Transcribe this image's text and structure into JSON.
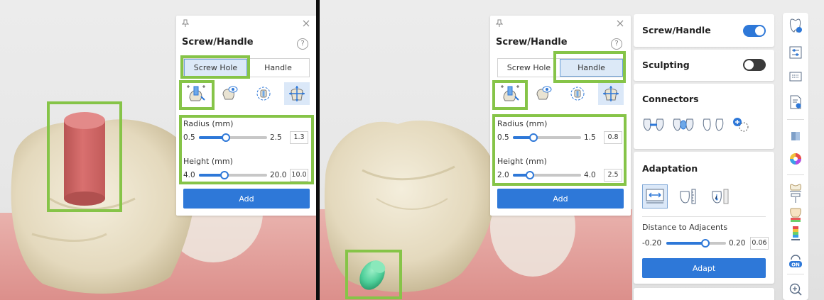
{
  "left_pane": {
    "panel": {
      "title": "Screw/Handle",
      "help": "?",
      "tabs": [
        {
          "label": "Screw Hole",
          "active": true
        },
        {
          "label": "Handle",
          "active": false
        }
      ],
      "tools": [
        "create-screw-icon",
        "view-screw-icon",
        "rotate-screw-icon",
        "move-screw-icon"
      ],
      "radius": {
        "label": "Radius (mm)",
        "min": "0.5",
        "max": "2.5",
        "value": "1.3",
        "fraction": 0.4
      },
      "height": {
        "label": "Height (mm)",
        "min": "4.0",
        "max": "20.0",
        "value": "10.0",
        "fraction": 0.38
      },
      "add_label": "Add"
    }
  },
  "right_pane": {
    "panel": {
      "title": "Screw/Handle",
      "help": "?",
      "tabs": [
        {
          "label": "Screw Hole",
          "active": false
        },
        {
          "label": "Handle",
          "active": true
        }
      ],
      "tools": [
        "create-handle-icon",
        "view-handle-icon",
        "rotate-handle-icon",
        "move-handle-icon"
      ],
      "radius": {
        "label": "Radius (mm)",
        "min": "0.5",
        "max": "1.5",
        "value": "0.8",
        "fraction": 0.3
      },
      "height": {
        "label": "Height (mm)",
        "min": "2.0",
        "max": "4.0",
        "value": "2.5",
        "fraction": 0.25
      },
      "add_label": "Add"
    },
    "sidebar": {
      "screw_handle": {
        "title": "Screw/Handle",
        "toggle_on": true
      },
      "sculpting": {
        "title": "Sculpting",
        "toggle_on": false
      },
      "connectors": {
        "title": "Connectors",
        "icons": [
          "connector-type-1-icon",
          "connector-type-2-icon",
          "connector-type-3-icon",
          "add-connector-icon"
        ]
      },
      "adaptation": {
        "title": "Adaptation",
        "icons": [
          "adapt-distance-icon",
          "adapt-tooth-icon",
          "adapt-ruler-icon"
        ],
        "distance": {
          "label": "Distance to Adjacents",
          "min": "-0.20",
          "max": "0.20",
          "value": "0.06",
          "fraction": 0.65
        },
        "adapt_label": "Adapt"
      }
    },
    "toolbar": [
      "tooth-info-icon",
      "settings-sliders-icon",
      "keyboard-icon",
      "report-icon",
      "cube-view-icon",
      "color-wheel-icon",
      "crown-section-icon",
      "tooth-layers-icon",
      "heatmap-icon",
      "occlusion-on-icon",
      "zoom-icon"
    ],
    "occlusion_badge": "ON"
  },
  "colors": {
    "accent": "#2e78d8",
    "highlight": "#86c448",
    "screw": "#d9706f",
    "handle": "#4fcf9a",
    "tooth": "#eae2cb",
    "gum": "#e8a7a4"
  }
}
